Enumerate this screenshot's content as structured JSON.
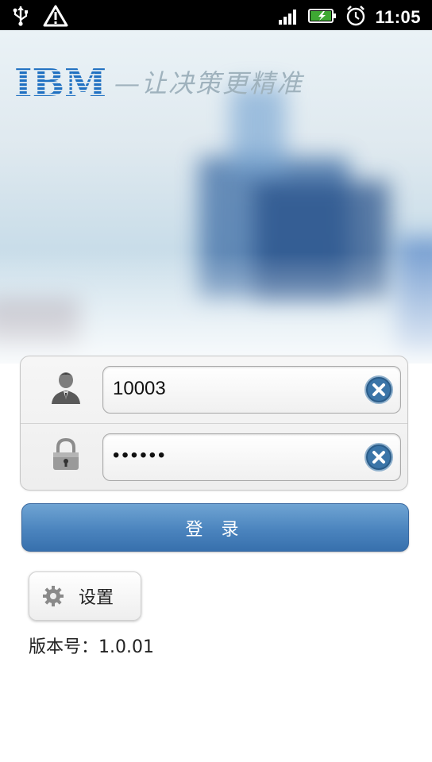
{
  "status_bar": {
    "left_icons": [
      "usb-icon",
      "warning-icon"
    ],
    "right_icons": [
      "signal-icon",
      "battery-icon",
      "alarm-icon"
    ],
    "time": "11:05"
  },
  "header": {
    "brand": "IBM",
    "slogan": "—让决策更精准"
  },
  "login": {
    "username_value": "10003",
    "password_mask": "••••••"
  },
  "buttons": {
    "login_label": "登 录",
    "settings_label": "设置"
  },
  "footer": {
    "version_text": "版本号：1.0.01"
  },
  "colors": {
    "login_button": "#4b84be",
    "clear_button": "#2b5d8a",
    "ibm_blue": "#1f70c1"
  }
}
